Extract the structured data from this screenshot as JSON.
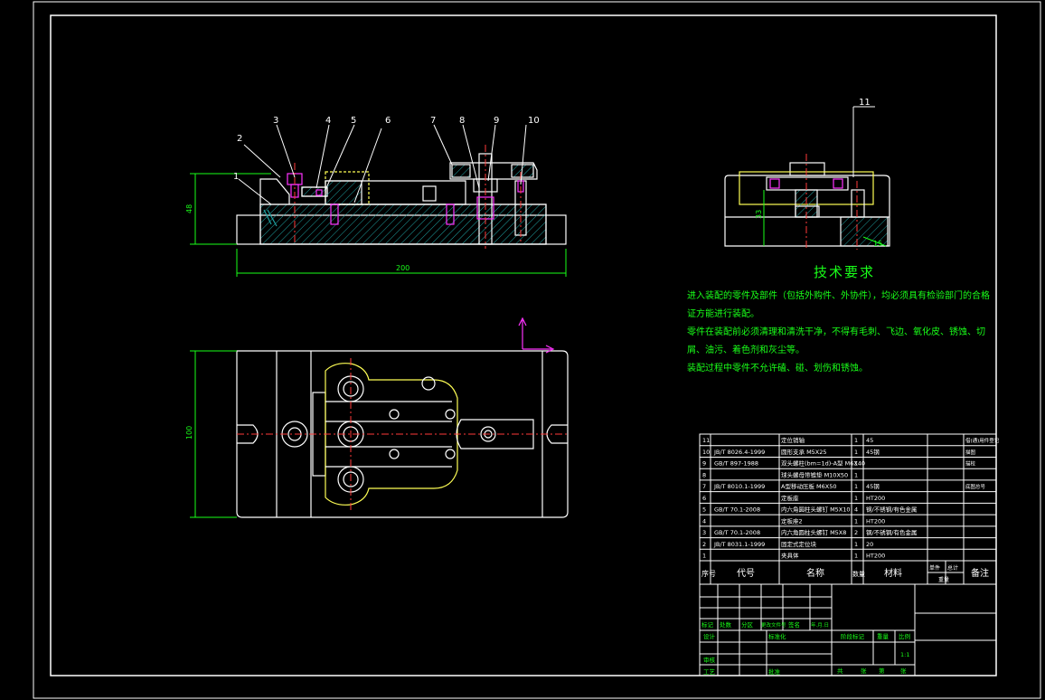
{
  "colors": {
    "bg": "#000000",
    "frame": "#ffffff",
    "part": "#ffffff",
    "hatch": "#1fa3a3",
    "dim": "#19ff19",
    "center": "#ff3a3a",
    "hidden": "#ffff55",
    "magenta": "#ff33ff",
    "text": "#19ff19"
  },
  "front_view": {
    "balloons": [
      "1",
      "2",
      "3",
      "4",
      "5",
      "6",
      "7",
      "8",
      "9",
      "10"
    ],
    "dim_length": "200",
    "dim_height": "48"
  },
  "side_view": {
    "balloon": "11",
    "dim_height": "33",
    "dim_small": "15"
  },
  "top_view": {
    "dim_width": "100"
  },
  "tech_req": {
    "title": "技术要求",
    "lines": [
      "进入装配的零件及部件（包括外购件、外协件），均必须具有检验部门的合格证方能进行装配。",
      "零件在装配前必须清理和清洗干净，不得有毛刺、飞边、氧化皮、锈蚀、切屑、油污、着色剂和灰尘等。",
      "装配过程中零件不允许磕、碰、划伤和锈蚀。"
    ]
  },
  "bom": {
    "rows": [
      {
        "no": "11",
        "code": "",
        "name": "定位销轴",
        "qty": "1",
        "mat": "45",
        "note": "借(通)用件登记"
      },
      {
        "no": "10",
        "code": "JB/T 8026.4-1999",
        "name": "圆形支承 M5X25",
        "qty": "1",
        "mat": "45钢",
        "note": "描图"
      },
      {
        "no": "9",
        "code": "GB/T 897-1988",
        "name": "双头螺柱(bm=1d)-A型 M6X40",
        "qty": "1",
        "mat": "",
        "note": "描校"
      },
      {
        "no": "8",
        "code": "",
        "name": "球头螺母带锥垫 M10X50",
        "qty": "1",
        "mat": "",
        "note": ""
      },
      {
        "no": "7",
        "code": "JB/T 8010.1-1999",
        "name": "A型移动压板 M6X50",
        "qty": "1",
        "mat": "45钢",
        "note": "底图总号"
      },
      {
        "no": "6",
        "code": "",
        "name": "定板座",
        "qty": "1",
        "mat": "HT200",
        "note": ""
      },
      {
        "no": "5",
        "code": "GB/T 70.1-2008",
        "name": "内六角圆柱头螺钉 M5X10",
        "qty": "4",
        "mat": "钢/不锈钢/有色金属",
        "note": ""
      },
      {
        "no": "4",
        "code": "",
        "name": "定板座2",
        "qty": "1",
        "mat": "HT200",
        "note": ""
      },
      {
        "no": "3",
        "code": "GB/T 70.1-2008",
        "name": "内六角圆柱头螺钉 M5X8",
        "qty": "2",
        "mat": "钢/不锈钢/有色金属",
        "note": ""
      },
      {
        "no": "2",
        "code": "JB/T 8031.1-1999",
        "name": "固定式定位块",
        "qty": "1",
        "mat": "20",
        "note": ""
      },
      {
        "no": "1",
        "code": "",
        "name": "夹具体",
        "qty": "1",
        "mat": "HT200",
        "note": ""
      }
    ],
    "header": {
      "no": "序号",
      "code": "代号",
      "name": "名称",
      "qty": "数量",
      "mat": "材料",
      "single": "单件",
      "total": "总计",
      "weight": "重量",
      "note": "备注"
    }
  },
  "title_block": {
    "rev_labels": [
      "标记",
      "处数",
      "分区",
      "更改文件号",
      "签名",
      "年.月.日"
    ],
    "roles": [
      "设计",
      "审核",
      "工艺"
    ],
    "std": "标准化",
    "approve": "批准",
    "stage": "阶段标记",
    "weight": "重量",
    "scale_label": "比例",
    "scale": "1:1",
    "sheets": [
      "共",
      "张",
      "第",
      "张"
    ]
  }
}
